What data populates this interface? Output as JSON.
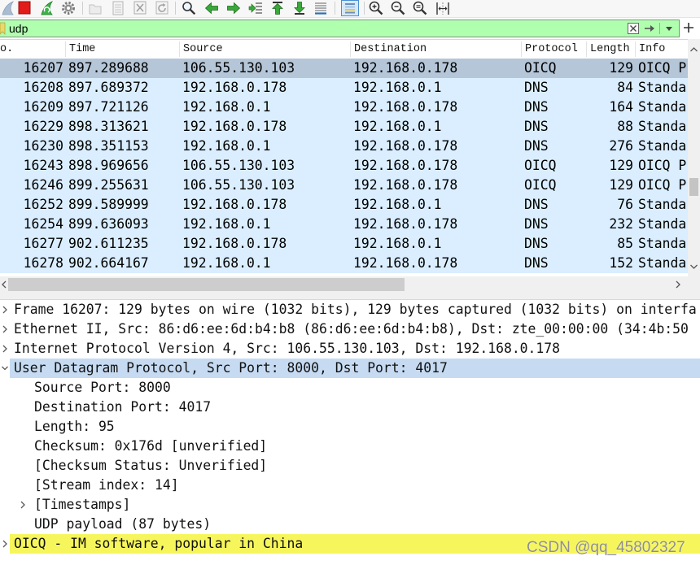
{
  "toolbar": {
    "icons": [
      "start-capture-icon",
      "stop-capture-icon",
      "restart-capture-icon",
      "capture-options-icon",
      "open-file-icon",
      "save-file-icon",
      "close-file-icon",
      "reload-file-icon",
      "find-packet-icon",
      "go-back-icon",
      "go-forward-icon",
      "go-to-packet-icon",
      "go-first-packet-icon",
      "go-last-packet-icon",
      "auto-scroll-icon",
      "colorize-icon",
      "zoom-in-icon",
      "zoom-out-icon",
      "normal-size-icon",
      "resize-columns-icon"
    ]
  },
  "display_filter": {
    "value": "udp",
    "icons": [
      "filter-bookmark-icon",
      "clear-filter-icon",
      "apply-filter-icon",
      "filter-history-dropdown-icon",
      "add-filter-button-icon"
    ]
  },
  "packet_list": {
    "columns": {
      "no": "o.",
      "time": "Time",
      "source": "Source",
      "destination": "Destination",
      "protocol": "Protocol",
      "length": "Length",
      "info": "Info"
    },
    "rows": [
      {
        "no": "16207",
        "time": "897.289688",
        "source": "106.55.130.103",
        "destination": "192.168.0.178",
        "protocol": "OICQ",
        "length": "129",
        "info": "OICQ P",
        "selected": true
      },
      {
        "no": "16208",
        "time": "897.689372",
        "source": "192.168.0.178",
        "destination": "192.168.0.1",
        "protocol": "DNS",
        "length": "84",
        "info": "Standa"
      },
      {
        "no": "16209",
        "time": "897.721126",
        "source": "192.168.0.1",
        "destination": "192.168.0.178",
        "protocol": "DNS",
        "length": "164",
        "info": "Standa"
      },
      {
        "no": "16229",
        "time": "898.313621",
        "source": "192.168.0.178",
        "destination": "192.168.0.1",
        "protocol": "DNS",
        "length": "88",
        "info": "Standa"
      },
      {
        "no": "16230",
        "time": "898.351153",
        "source": "192.168.0.1",
        "destination": "192.168.0.178",
        "protocol": "DNS",
        "length": "276",
        "info": "Standa"
      },
      {
        "no": "16243",
        "time": "898.969656",
        "source": "106.55.130.103",
        "destination": "192.168.0.178",
        "protocol": "OICQ",
        "length": "129",
        "info": "OICQ P"
      },
      {
        "no": "16246",
        "time": "899.255631",
        "source": "106.55.130.103",
        "destination": "192.168.0.178",
        "protocol": "OICQ",
        "length": "129",
        "info": "OICQ P"
      },
      {
        "no": "16252",
        "time": "899.589999",
        "source": "192.168.0.178",
        "destination": "192.168.0.1",
        "protocol": "DNS",
        "length": "76",
        "info": "Standa"
      },
      {
        "no": "16254",
        "time": "899.636093",
        "source": "192.168.0.1",
        "destination": "192.168.0.178",
        "protocol": "DNS",
        "length": "232",
        "info": "Standa"
      },
      {
        "no": "16277",
        "time": "902.611235",
        "source": "192.168.0.178",
        "destination": "192.168.0.1",
        "protocol": "DNS",
        "length": "85",
        "info": "Standa"
      },
      {
        "no": "16278",
        "time": "902.664167",
        "source": "192.168.0.1",
        "destination": "192.168.0.178",
        "protocol": "DNS",
        "length": "152",
        "info": "Standa"
      }
    ]
  },
  "packet_details": {
    "tree": [
      {
        "label": "Frame 16207: 129 bytes on wire (1032 bits), 129 bytes captured (1032 bits) on interfa",
        "collapsed": true
      },
      {
        "label": "Ethernet II, Src: 86:d6:ee:6d:b4:b8 (86:d6:ee:6d:b4:b8), Dst: zte_00:00:00 (34:4b:50",
        "collapsed": true
      },
      {
        "label": "Internet Protocol Version 4, Src: 106.55.130.103, Dst: 192.168.0.178",
        "collapsed": true
      },
      {
        "label": "User Datagram Protocol, Src Port: 8000, Dst Port: 4017",
        "selected": true,
        "children": [
          {
            "label": "Source Port: 8000"
          },
          {
            "label": "Destination Port: 4017"
          },
          {
            "label": "Length: 95"
          },
          {
            "label": "Checksum: 0x176d [unverified]"
          },
          {
            "label": "[Checksum Status: Unverified]"
          },
          {
            "label": "[Stream index: 14]"
          },
          {
            "label": "[Timestamps]",
            "collapsed": true
          },
          {
            "label": "UDP payload (87 bytes)"
          }
        ]
      },
      {
        "label": "OICQ - IM software, popular in China",
        "collapsed": true,
        "highlighted": true
      }
    ]
  },
  "watermark": "CSDN @qq_45802327",
  "colors": {
    "filter_ok": "#afffaf",
    "udp_row": "#daeeff",
    "selected_row": "#b5c6d8",
    "selected_field": "#c6dbf2",
    "highlighted_field": "#f6f65c"
  }
}
